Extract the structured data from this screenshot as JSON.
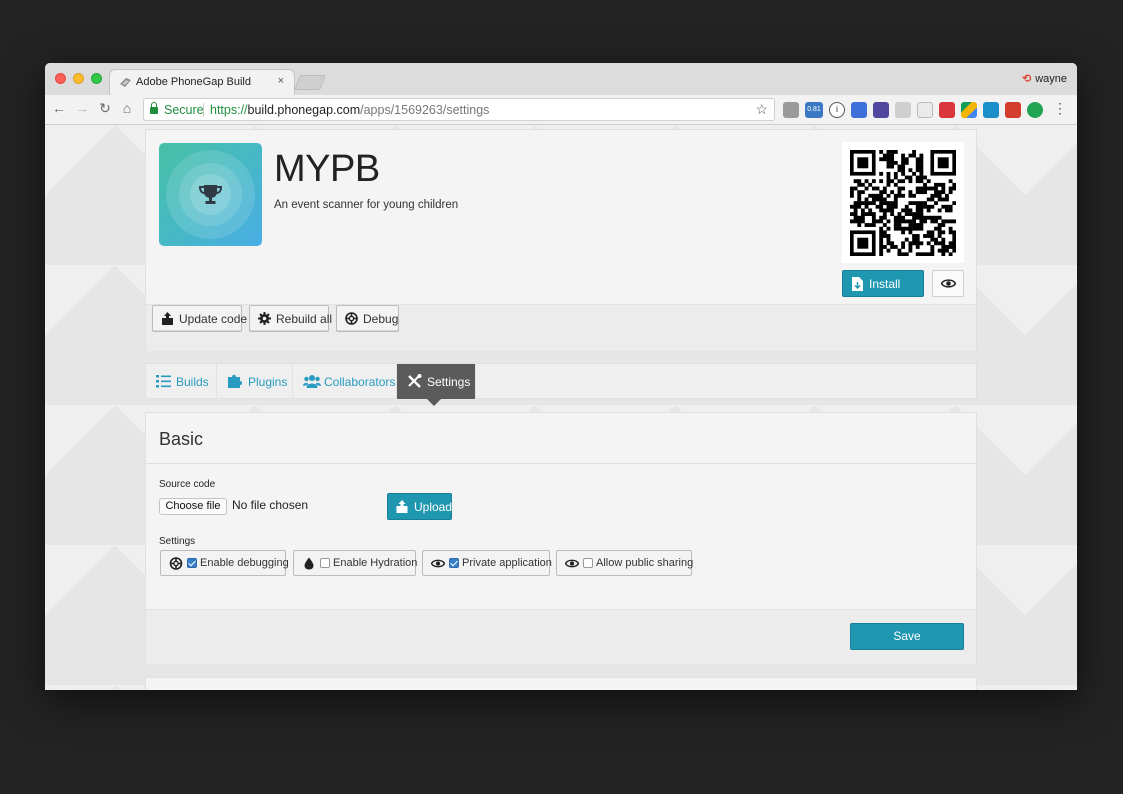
{
  "browser": {
    "tab_title": "Adobe PhoneGap Build",
    "tab_close": "×",
    "profile_name": "wayne",
    "secure_label": "Secure",
    "url_protocol": "https://",
    "url_host": "build.phonegap.com",
    "url_path": "/apps/1569263/settings",
    "extension_badge": "0.81"
  },
  "app": {
    "name": "MYPB",
    "description": "An event scanner for young children",
    "install_label": "Install",
    "actions": {
      "update_code": "Update code",
      "rebuild_all": "Rebuild all",
      "debug": "Debug"
    }
  },
  "tabs": [
    {
      "label": "Builds",
      "active": false
    },
    {
      "label": "Plugins",
      "active": false
    },
    {
      "label": "Collaborators",
      "active": false
    },
    {
      "label": "Settings",
      "active": true
    }
  ],
  "basic": {
    "title": "Basic",
    "source_code_label": "Source code",
    "choose_file_label": "Choose file",
    "no_file_text": "No file chosen",
    "upload_label": "Upload",
    "settings_label": "Settings",
    "options": [
      {
        "label": "Enable debugging",
        "checked": true,
        "icon": "lifebuoy-icon"
      },
      {
        "label": "Enable Hydration",
        "checked": false,
        "icon": "droplet-icon"
      },
      {
        "label": "Private application",
        "checked": true,
        "icon": "eye-icon"
      },
      {
        "label": "Allow public sharing",
        "checked": false,
        "icon": "eye-icon"
      }
    ],
    "save_label": "Save"
  },
  "colors": {
    "accent": "#1f97b1",
    "active_tab": "#5b5b5b",
    "link": "#2a9bc0",
    "secure_green": "#1e8e3e"
  }
}
